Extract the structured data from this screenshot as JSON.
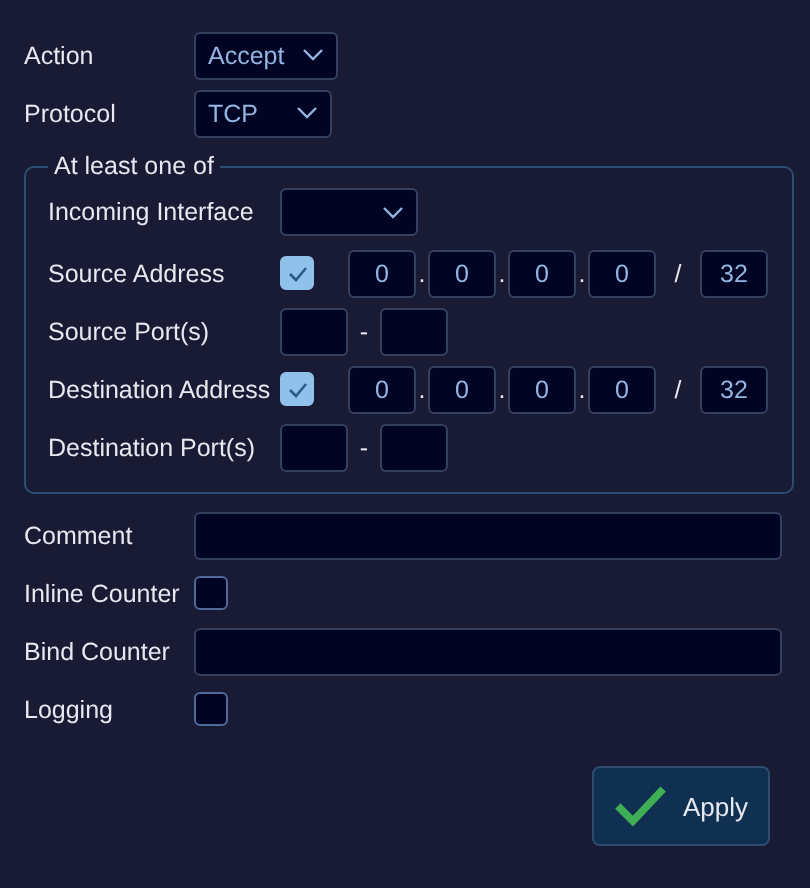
{
  "action": {
    "label": "Action",
    "value": "Accept"
  },
  "protocol": {
    "label": "Protocol",
    "value": "TCP"
  },
  "match_group": {
    "legend": "At least one of",
    "rows": [
      {
        "kind": "dropdown",
        "label": "Incoming Interface"
      },
      {
        "kind": "address",
        "label": "Source Address",
        "checked": true,
        "octets": [
          "0",
          "0",
          "0",
          "0"
        ],
        "dot": ".",
        "slash": "/",
        "prefix": "32"
      },
      {
        "kind": "ports",
        "label": "Source Port(s)",
        "dash": "-"
      },
      {
        "kind": "address",
        "label": "Destination Address",
        "checked": true,
        "octets": [
          "0",
          "0",
          "0",
          "0"
        ],
        "dot": ".",
        "slash": "/",
        "prefix": "32"
      },
      {
        "kind": "ports",
        "label": "Destination Port(s)",
        "dash": "-"
      }
    ]
  },
  "options": [
    {
      "kind": "text",
      "label": "Comment"
    },
    {
      "kind": "checkbox",
      "label": "Inline Counter",
      "checked": false
    },
    {
      "kind": "text",
      "label": "Bind Counter"
    },
    {
      "kind": "checkbox",
      "label": "Logging",
      "checked": false
    }
  ],
  "apply_button": {
    "label": "Apply"
  }
}
